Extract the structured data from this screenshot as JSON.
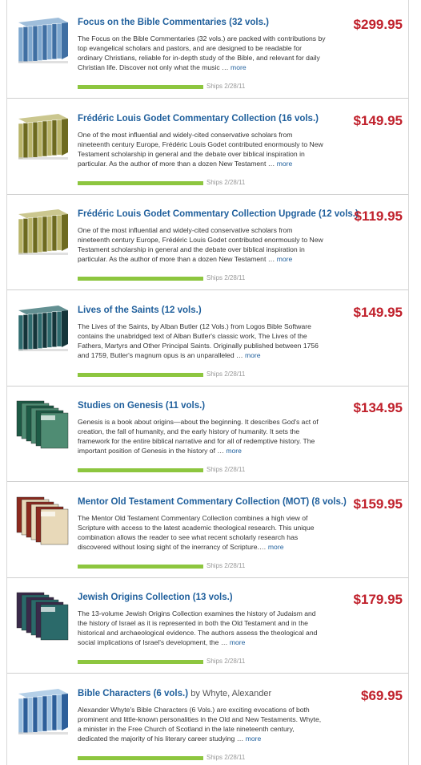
{
  "products": [
    {
      "title": "Focus on the Bible Commentaries (32 vols.)",
      "author": "",
      "description": "The Focus on the Bible Commentaries (32 vols.) are packed with contributions by top evangelical scholars and pastors, and are designed to be readable for ordinary Christians, reliable for in-depth study of the Bible, and relevant for daily Christian life. Discover not only what the music …",
      "more": "more",
      "price": "$299.95",
      "ships": "Ships 2/28/11",
      "progress": 1.0,
      "thumb_icon": "book-collection-icon",
      "colors": [
        "#3f6fa3",
        "#7fa8cf"
      ]
    },
    {
      "title": "Frédéric Louis Godet Commentary Collection (16 vols.)",
      "author": "",
      "description": "One of the most influential and widely-cited conservative scholars from nineteenth century Europe, Frédéric Louis Godet contributed enormously to New Testament scholarship in general and the debate over biblical inspiration in particular. As the author of more than a dozen New Testament …",
      "more": "more",
      "price": "$149.95",
      "ships": "Ships 2/28/11",
      "progress": 1.0,
      "thumb_icon": "book-collection-icon",
      "colors": [
        "#6d6a1f",
        "#b9b46a"
      ]
    },
    {
      "title": "Frédéric Louis Godet Commentary Collection Upgrade (12 vols.)",
      "author": "",
      "description": "One of the most influential and widely-cited conservative scholars from nineteenth century Europe, Frédéric Louis Godet contributed enormously to New Testament scholarship in general and the debate over biblical inspiration in particular. As the author of more than a dozen New Testament …",
      "more": "more",
      "price": "$119.95",
      "ships": "Ships 2/28/11",
      "progress": 1.0,
      "thumb_icon": "book-collection-icon",
      "colors": [
        "#6d6a1f",
        "#b9b46a"
      ]
    },
    {
      "title": "Lives of the Saints (12 vols.)",
      "author": "",
      "description": "The Lives of the Saints, by Alban Butler (12 Vols.) from Logos Bible Software contains the unabridged text of Alban Butler's classic work, The Lives of the Fathers, Martyrs and Other Principal Saints. Originally published between 1756 and 1759, Butler's magnum opus is an unparalleled …",
      "more": "more",
      "price": "$149.95",
      "ships": "Ships 2/28/11",
      "progress": 1.0,
      "thumb_icon": "book-collection-icon",
      "colors": [
        "#14353a",
        "#2f6b6e"
      ]
    },
    {
      "title": "Studies on Genesis (11 vols.)",
      "author": "",
      "description": "Genesis is a book about origins—about the beginning. It describes God's act of creation, the fall of humanity, and the early history of humanity. It sets the framework for the entire biblical narrative and for all of redemptive history. The important position of Genesis in the history of …",
      "more": "more",
      "price": "$134.95",
      "ships": "Ships 2/28/11",
      "progress": 1.0,
      "thumb_icon": "book-stack-icon",
      "colors": [
        "#1d5a45",
        "#4f8c73"
      ]
    },
    {
      "title": "Mentor Old Testament Commentary Collection (MOT) (8 vols.)",
      "author": "",
      "description": "The Mentor Old Testament Commentary Collection combines a high view of Scripture with access to the latest academic theological research. This unique combination allows the reader to see what recent scholarly research has discovered without losing sight of the inerrancy of Scripture.…",
      "more": "more",
      "price": "$159.95",
      "ships": "Ships 2/28/11",
      "progress": 1.0,
      "thumb_icon": "book-stack-icon",
      "colors": [
        "#8c2a1f",
        "#e8d9b9"
      ]
    },
    {
      "title": "Jewish Origins Collection (13 vols.)",
      "author": "",
      "description": "The 13-volume Jewish Origins Collection examines the history of Judaism and the history of Israel as it is represented in both the Old Testament and in the historical and archaeological evidence. The authors assess the theological and social implications of Israel's development, the …",
      "more": "more",
      "price": "$179.95",
      "ships": "Ships 2/28/11",
      "progress": 1.0,
      "thumb_icon": "book-stack-icon",
      "colors": [
        "#3a2a4a",
        "#2b6a6a"
      ]
    },
    {
      "title": "Bible Characters (6 vols.)",
      "author": "by Whyte, Alexander",
      "description": "Alexander Whyte's Bible Characters (6 Vols.) are exciting evocations of both prominent and little-known personalities in the Old and New Testaments. Whyte, a minister in the Free Church of Scotland in the late nineteenth century, dedicated the majority of his literary career studying …",
      "more": "more",
      "price": "$69.95",
      "ships": "Ships 2/28/11",
      "progress": 1.0,
      "thumb_icon": "book-collection-icon",
      "colors": [
        "#2d5f9a",
        "#9cc0e0"
      ]
    }
  ],
  "colors": {
    "title": "#1f5f9c",
    "price": "#c0202b",
    "progress": "#8dc63f"
  }
}
